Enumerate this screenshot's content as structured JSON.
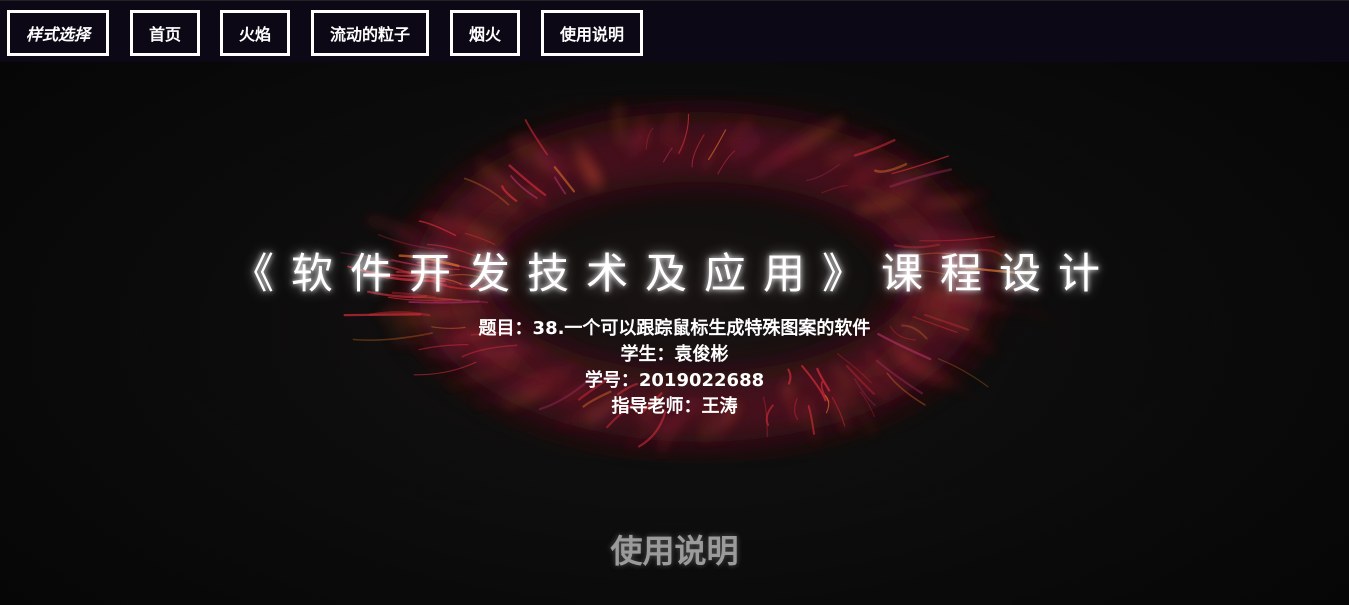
{
  "nav": {
    "items": [
      {
        "label": "样式选择",
        "italic": true
      },
      {
        "label": "首页",
        "italic": false
      },
      {
        "label": "火焰",
        "italic": false
      },
      {
        "label": "流动的粒子",
        "italic": false
      },
      {
        "label": "烟火",
        "italic": false
      },
      {
        "label": "使用说明",
        "italic": false
      }
    ]
  },
  "main": {
    "title": "《软件开发技术及应用》课程设计",
    "info": [
      "题目：38.一个可以跟踪鼠标生成特殊图案的软件",
      "学生：袁俊彬",
      "学号：2019022688",
      "指导老师：王涛"
    ],
    "usage_heading": "使用说明"
  },
  "colors": {
    "nav_background": "#0c0815",
    "page_background": "#0b0b0b",
    "particle_red": "#e0303c",
    "particle_orange": "#e8782a",
    "particle_magenta": "#b0306a",
    "usage_heading": "#9b9b9b"
  }
}
